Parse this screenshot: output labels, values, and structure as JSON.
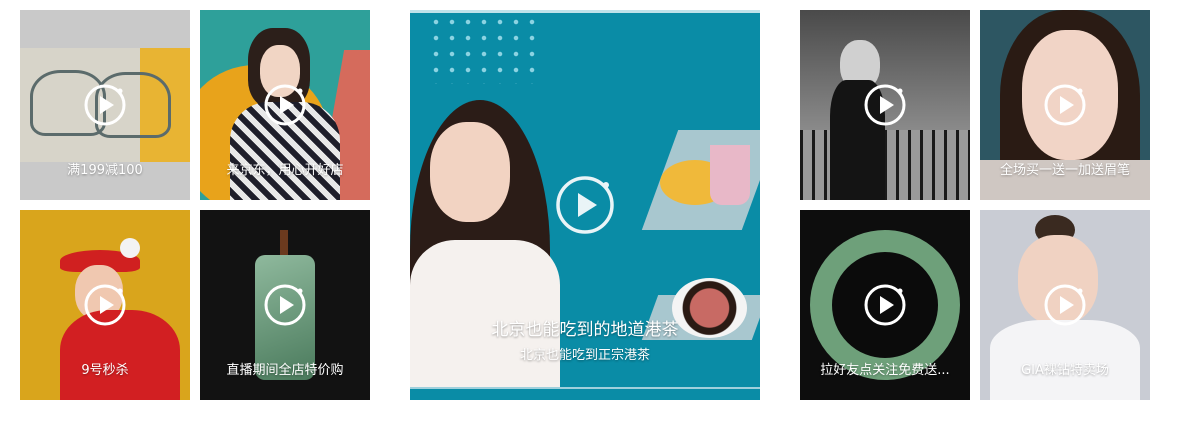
{
  "tiles": [
    {
      "caption": "满199减100"
    },
    {
      "caption": "来京东，用心开好店"
    },
    {
      "caption": "9号秒杀"
    },
    {
      "caption": "直播期间全店特价购"
    },
    {
      "caption": "全场买一送一加送眉笔"
    },
    {
      "caption": "拉好友点关注免费送..."
    },
    {
      "caption": "GIA裸钻特卖场"
    }
  ],
  "featured": {
    "title": "北京也能吃到的地道港茶",
    "subtitle": "北京也能吃到正宗港茶"
  },
  "colors": {
    "featured_bg": "#0a8ca6",
    "tile_overlay": "rgba(0,0,0,0.25)"
  },
  "icons": {
    "play": "play-circle-icon"
  }
}
